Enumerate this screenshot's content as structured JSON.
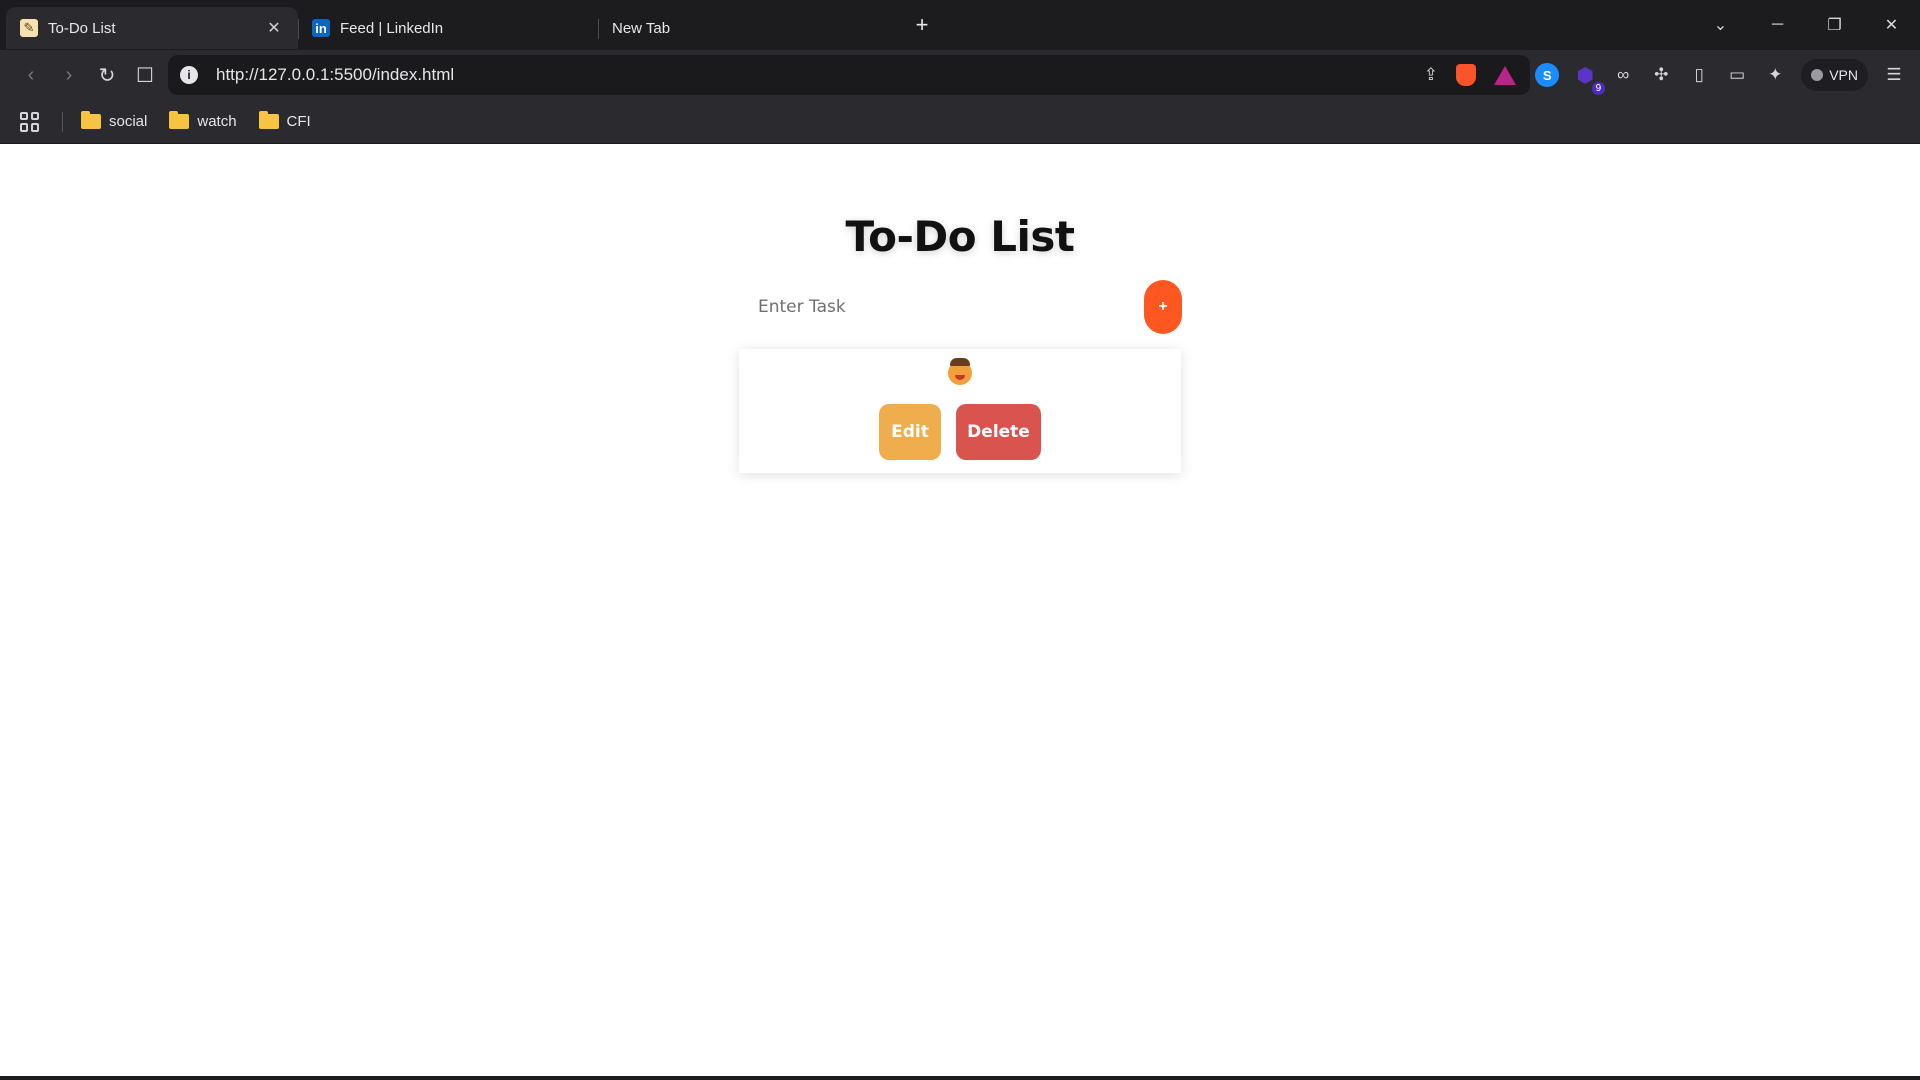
{
  "browser": {
    "tabs": [
      {
        "title": "To-Do List",
        "active": true,
        "favicon": "note-icon"
      },
      {
        "title": "Feed | LinkedIn",
        "active": false,
        "favicon": "linkedin-icon"
      },
      {
        "title": "New Tab",
        "active": false,
        "favicon": ""
      }
    ],
    "url": "http://127.0.0.1:5500/index.html",
    "vpn_label": "VPN",
    "extension_badge": "9",
    "bookmarks": [
      {
        "label": "social"
      },
      {
        "label": "watch"
      },
      {
        "label": "CFI"
      }
    ]
  },
  "app": {
    "title": "To-Do List",
    "input_placeholder": "Enter Task",
    "input_value": "",
    "add_button_label": "+",
    "tasks": [
      {
        "content": "cowboy-face-emoji",
        "edit_label": "Edit",
        "delete_label": "Delete"
      }
    ]
  },
  "colors": {
    "accent": "#ff5722",
    "edit": "#f0ad4e",
    "delete": "#d9534f",
    "chrome_dark": "#1c1c1f",
    "chrome": "#2b2b2f"
  }
}
